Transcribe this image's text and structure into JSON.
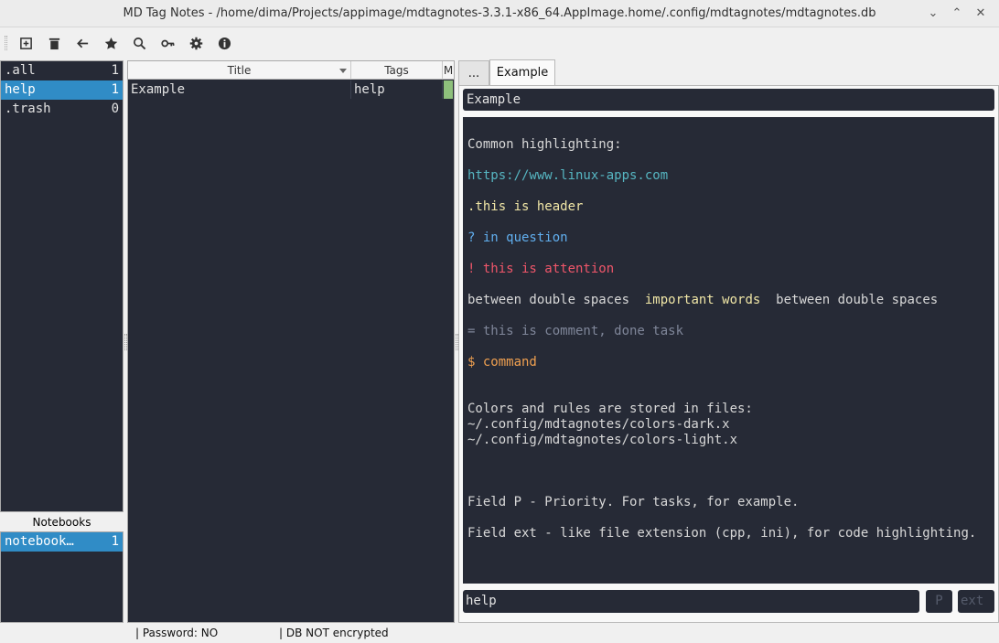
{
  "window": {
    "title": "MD Tag Notes - /home/dima/Projects/appimage/mdtagnotes-3.3.1-x86_64.AppImage.home/.config/mdtagnotes/mdtagnotes.db",
    "minimize": "⌄",
    "restore": "⌃",
    "close": "✕"
  },
  "toolbar": {
    "buttons": [
      "add-note",
      "delete-note",
      "back",
      "favorite",
      "search",
      "password",
      "settings",
      "about"
    ]
  },
  "tags": [
    {
      "label": ".all",
      "count": "1"
    },
    {
      "label": "help",
      "count": "1"
    },
    {
      "label": ".trash",
      "count": "0"
    }
  ],
  "notebooks": {
    "header": "Notebooks",
    "items": [
      {
        "label": "notebook…",
        "count": "1"
      }
    ]
  },
  "notes_table": {
    "columns": [
      "Title",
      "Tags",
      "M"
    ],
    "rows": [
      {
        "title": "Example",
        "tags": "help"
      }
    ]
  },
  "tabs": [
    {
      "label": "..."
    },
    {
      "label": "Example"
    }
  ],
  "editor": {
    "title": "Example",
    "lines": {
      "l1": "Common highlighting:",
      "l2": "https://www.linux-apps.com",
      "l3": ".this is header",
      "l4": "? in question",
      "l5": "! this is attention",
      "l6a": "between double spaces  ",
      "l6b": "important words",
      "l6c": "  between double spaces",
      "l7": "= this is comment, done task",
      "l8": "$ command",
      "l9": "Colors and rules are stored in files:",
      "l10": "~/.config/mdtagnotes/colors-dark.x",
      "l11": "~/.config/mdtagnotes/colors-light.x",
      "l12": "Field P - Priority. For tasks, for example.",
      "l13": "Field ext - like file extension (cpp, ini), for code highlighting."
    },
    "tags_value": "help",
    "priority_placeholder": "P",
    "ext_placeholder": "ext"
  },
  "status": {
    "password": "| Password: NO",
    "encryption": "| DB NOT encrypted"
  },
  "colors": {
    "dark_bg": "#262a36",
    "selection": "#308cc6",
    "link": "#56b6c2",
    "header": "#f0e6a6",
    "question": "#61afef",
    "attention": "#f0566a",
    "comment": "#7f8699",
    "command": "#f0a050"
  }
}
